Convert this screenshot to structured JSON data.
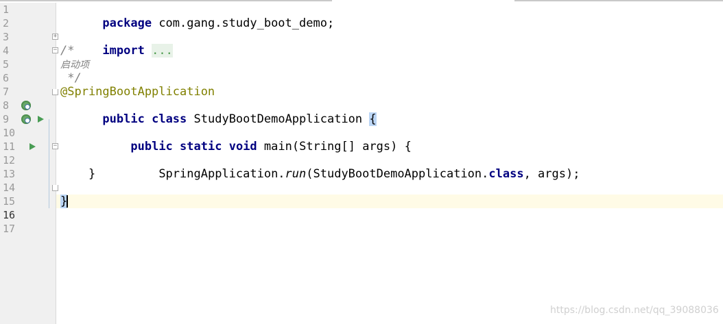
{
  "line_numbers": [
    "1",
    "2",
    "3",
    "4",
    "5",
    "6",
    "7",
    "8",
    "9",
    "10",
    "11",
    "12",
    "13",
    "14",
    "15",
    "16",
    "17"
  ],
  "code": {
    "line1": {
      "kw": "package",
      "rest": " com.gang.study_boot_demo;"
    },
    "line3": {
      "kw": "import",
      "space": " ",
      "placeholder": "..."
    },
    "line4": {
      "text": "/*"
    },
    "line5": {
      "text": "启动项"
    },
    "line6": {
      "text": " */"
    },
    "line7": {
      "text": "@SpringBootApplication"
    },
    "line8": {
      "kw1": "public",
      "kw2": "class",
      "name": " StudyBootDemoApplication ",
      "brace": "{"
    },
    "line10": {
      "indent": "    ",
      "kw1": "public",
      "kw2": "static",
      "kw3": "void",
      "rest": " main(String[] args) {"
    },
    "line12": {
      "indent": "        ",
      "pre": "SpringApplication.",
      "method": "run",
      "mid": "(StudyBootDemoApplication.",
      "kw": "class",
      "post": ", args);"
    },
    "line13": {
      "text": "    }"
    },
    "line15": {
      "brace": "}"
    }
  },
  "gutter_icons": {
    "line8": "spring-bean-icon",
    "line9": [
      "spring-bean-icon",
      "run-icon"
    ],
    "line11": "run-icon"
  },
  "colors": {
    "keyword": "#000080",
    "comment": "#808080",
    "annotation": "#808000",
    "current_line": "#fffbe6",
    "brace_match": "#bcd6f5",
    "run_green": "#499c54"
  },
  "watermark": "https://blog.csdn.net/qq_39088036"
}
